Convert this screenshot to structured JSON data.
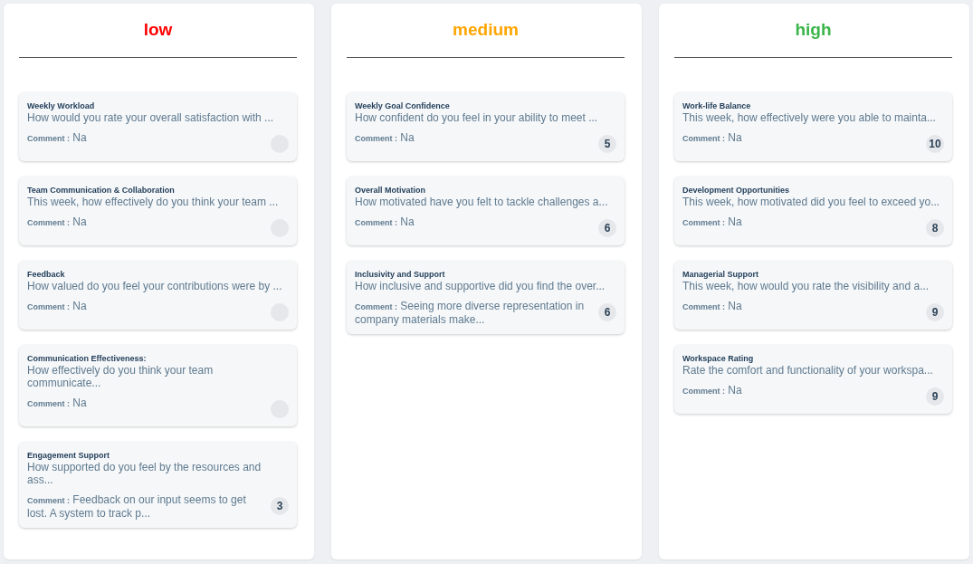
{
  "columns": [
    {
      "title": "low",
      "color": "#ff0000",
      "cards": [
        {
          "title": "Weekly Workload",
          "question": "How would you rate your overall satisfaction with ...",
          "comment_label": "Comment :",
          "comment": "Na"
        },
        {
          "title": "Team Communication & Collaboration",
          "question": "This week, how effectively do you think your team ...",
          "comment_label": "Comment :",
          "comment": "Na"
        },
        {
          "title": "Feedback",
          "question": "How valued do you feel your contributions were by ...",
          "comment_label": "Comment :",
          "comment": "Na"
        },
        {
          "title": "Communication Effectiveness:",
          "question": "How effectively do you think your team communicate...",
          "comment_label": "Comment :",
          "comment": "Na"
        },
        {
          "title": "Engagement Support",
          "question": "How supported do you feel by the resources and ass...",
          "comment_label": "Comment :",
          "comment": "Feedback on our input seems to get lost. A system to track p...",
          "score": "3"
        }
      ]
    },
    {
      "title": "medium",
      "color": "#ffa500",
      "cards": [
        {
          "title": "Weekly Goal Confidence",
          "question": "How confident do you feel in your ability to meet ...",
          "comment_label": "Comment :",
          "comment": "Na",
          "score": "5"
        },
        {
          "title": "Overall Motivation",
          "question": "How motivated have you felt to tackle challenges a...",
          "comment_label": "Comment :",
          "comment": "Na",
          "score": "6"
        },
        {
          "title": "Inclusivity and Support",
          "question": "How inclusive and supportive did you find the over...",
          "comment_label": "Comment :",
          "comment": "Seeing more diverse representation in company materials make...",
          "score": "6"
        }
      ]
    },
    {
      "title": "high",
      "color": "#3cb54a",
      "cards": [
        {
          "title": "Work-life Balance",
          "question": "This week, how effectively were you able to mainta...",
          "comment_label": "Comment :",
          "comment": "Na",
          "score": "10"
        },
        {
          "title": "Development Opportunities",
          "question": "This week, how motivated did you feel to exceed yo...",
          "comment_label": "Comment :",
          "comment": "Na",
          "score": "8"
        },
        {
          "title": "Managerial Support",
          "question": "This week, how would you rate the visibility and a...",
          "comment_label": "Comment :",
          "comment": "Na",
          "score": "9"
        },
        {
          "title": "Workspace Rating",
          "question": "Rate the comfort and functionality of your workspa...",
          "comment_label": "Comment :",
          "comment": "Na",
          "score": "9"
        }
      ]
    }
  ]
}
